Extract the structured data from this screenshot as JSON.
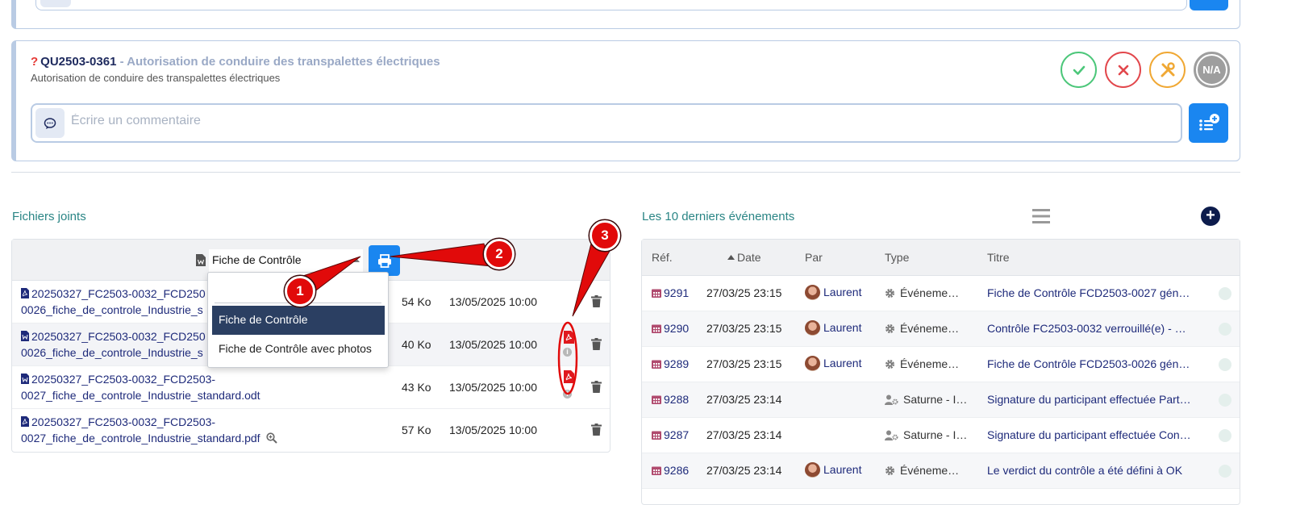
{
  "question": {
    "ref": "QU2503-0361",
    "title_suffix": " - Autorisation de conduire des transpalettes électriques",
    "subtitle": "Autorisation de conduire des transpalettes électriques",
    "verdicts": {
      "na_label": "N/A"
    },
    "comment_placeholder": "Écrire un commentaire"
  },
  "attachments": {
    "section_title": "Fichiers joints",
    "template_selected": "Fiche de Contrôle",
    "dropdown_options": [
      "Fiche de Contrôle",
      "Fiche de Contrôle avec photos"
    ],
    "files": [
      {
        "name": "20250327_FC2503-0032_FCD2503-0026_fiche_de_controle_Industrie_standard.pdf",
        "type": "pdf",
        "size": "54 Ko",
        "date": "13/05/2025 10:00"
      },
      {
        "name": "20250327_FC2503-0032_FCD2503-0026_fiche_de_controle_Industrie_standard.odt",
        "type": "odt",
        "size": "40 Ko",
        "date": "13/05/2025 10:00"
      },
      {
        "name": "20250327_FC2503-0032_FCD2503-0027_fiche_de_controle_Industrie_standard.odt",
        "type": "odt",
        "size": "43 Ko",
        "date": "13/05/2025 10:00"
      },
      {
        "name": "20250327_FC2503-0032_FCD2503-0027_fiche_de_controle_Industrie_standard.pdf",
        "type": "pdf",
        "size": "57 Ko",
        "date": "13/05/2025 10:00"
      }
    ],
    "visible_names": [
      "20250327_FC2503-0032_FCD250",
      "0026_fiche_de_controle_Industrie_s",
      "20250327_FC2503-0032_FCD250",
      "0026_fiche_de_controle_Industrie_s",
      "20250327_FC2503-0032_FCD2503-",
      "0027_fiche_de_controle_Industrie_standard.odt",
      "20250327_FC2503-0032_FCD2503-",
      "0027_fiche_de_controle_Industrie_standard.pdf"
    ]
  },
  "events": {
    "section_title": "Les 10 derniers événements",
    "columns": [
      "Réf.",
      "Date",
      "Par",
      "Type",
      "Titre"
    ],
    "rows": [
      {
        "ref": "9291",
        "date": "27/03/25 23:15",
        "par": "Laurent",
        "type": "Événeme…",
        "title": "Fiche de Contrôle FCD2503-0027 gén…"
      },
      {
        "ref": "9290",
        "date": "27/03/25 23:15",
        "par": "Laurent",
        "type": "Événeme…",
        "title": "Contrôle FC2503-0032 verrouillé(e) - …"
      },
      {
        "ref": "9289",
        "date": "27/03/25 23:15",
        "par": "Laurent",
        "type": "Événeme…",
        "title": "Fiche de Contrôle FCD2503-0026 gén…"
      },
      {
        "ref": "9288",
        "date": "27/03/25 23:14",
        "par": "",
        "type": "Saturne - I…",
        "title": "Signature du participant effectuée Part…"
      },
      {
        "ref": "9287",
        "date": "27/03/25 23:14",
        "par": "",
        "type": "Saturne - I…",
        "title": "Signature du participant effectuée Con…"
      },
      {
        "ref": "9286",
        "date": "27/03/25 23:14",
        "par": "Laurent",
        "type": "Événeme…",
        "title": "Le verdict du contrôle a été défini à OK"
      }
    ]
  },
  "annotations": [
    "1",
    "2",
    "3"
  ],
  "colors": {
    "primary": "#1a86f0",
    "ok": "#4cc77a",
    "ko": "#e2474c",
    "fix": "#f0a834",
    "na": "#9e9e9e",
    "annotation": "#e10a0a"
  }
}
